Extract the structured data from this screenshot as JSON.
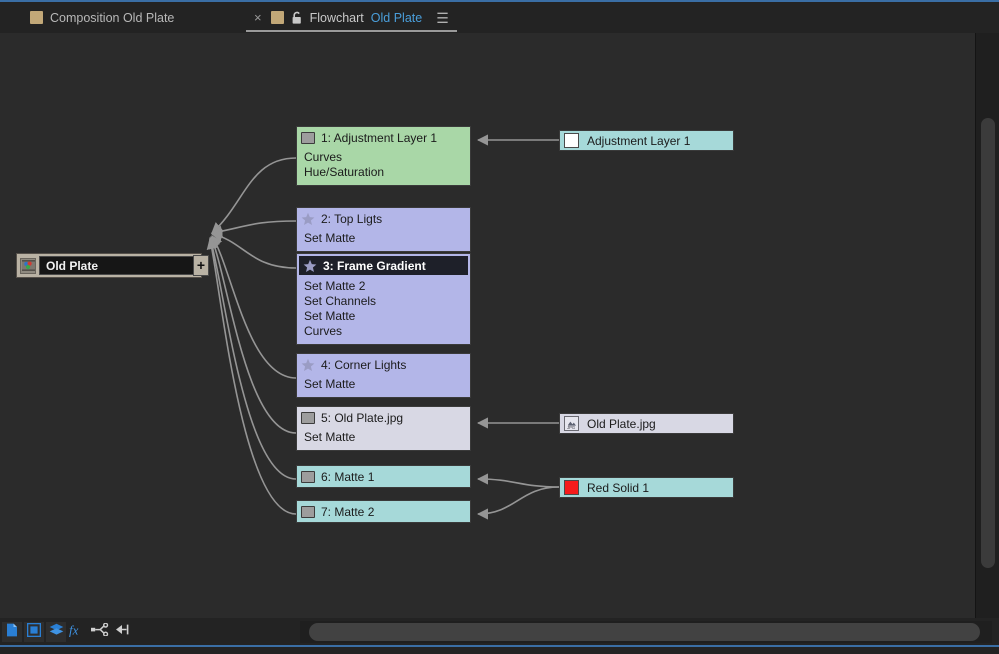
{
  "window": {
    "accent_color": "#3a6ea5",
    "canvas_bg": "#2b2b2b",
    "panel_bg": "#232323"
  },
  "tabs": {
    "inactive": {
      "label": "Composition Old Plate",
      "icon": "composition-swatch-icon"
    },
    "active": {
      "close_label": "×",
      "icon": "composition-swatch-icon",
      "lock_icon": "lock-icon",
      "prefix": "Flowchart",
      "name": "Old Plate",
      "menu_icon": "panel-menu-icon",
      "name_color": "#4a9eda"
    }
  },
  "composition_node": {
    "name": "Old Plate",
    "icon": "composition-thumbnail-icon",
    "expander_label": "+",
    "expander_name": "expand-composition-button"
  },
  "layer_nodes": [
    {
      "index": "1",
      "title": "1: Adjustment Layer 1",
      "icon": "layer-square-icon",
      "color": "#a9d7a7",
      "selected": false,
      "effects": [
        "Curves",
        "Hue/Saturation"
      ]
    },
    {
      "index": "2",
      "title": "2: Top Ligts",
      "icon": "shape-star-icon",
      "color": "#b3b6e8",
      "selected": false,
      "effects": [
        "Set Matte"
      ]
    },
    {
      "index": "3",
      "title": "3: Frame Gradient",
      "icon": "shape-star-icon",
      "color": "#b3b6e8",
      "selected": true,
      "effects": [
        "Set Matte 2",
        "Set Channels",
        "Set Matte",
        "Curves"
      ]
    },
    {
      "index": "4",
      "title": "4: Corner Lights",
      "icon": "shape-star-icon",
      "color": "#b3b6e8",
      "selected": false,
      "effects": [
        "Set Matte"
      ]
    },
    {
      "index": "5",
      "title": "5: Old Plate.jpg",
      "icon": "layer-square-icon",
      "color": "#d8d8e4",
      "selected": false,
      "effects": [
        "Set Matte"
      ]
    },
    {
      "index": "6",
      "title": "6: Matte 1",
      "icon": "layer-square-icon",
      "color": "#a6d9d9",
      "selected": false,
      "effects": []
    },
    {
      "index": "7",
      "title": "7: Matte 2",
      "icon": "layer-square-icon",
      "color": "#a6d9d9",
      "selected": false,
      "effects": []
    }
  ],
  "source_nodes": [
    {
      "title": "Adjustment Layer 1",
      "icon": "white-solid-swatch-icon",
      "swatch_color": "#ffffff",
      "color": "#a6d9d9"
    },
    {
      "title": "Old Plate.jpg",
      "icon": "jpeg-file-icon",
      "swatch_color": "#d8d8e4",
      "color": "#d8d8e4"
    },
    {
      "title": "Red Solid 1",
      "icon": "red-solid-swatch-icon",
      "swatch_color": "#f51b1b",
      "color": "#a6d9d9"
    }
  ],
  "toolbar": {
    "buttons": [
      {
        "name": "show-compositions-button",
        "icon": "page-icon"
      },
      {
        "name": "show-solids-button",
        "icon": "solid-square-icon"
      },
      {
        "name": "show-layers-button",
        "icon": "layers-icon"
      },
      {
        "name": "show-effects-button",
        "icon": "fx-icon"
      },
      {
        "name": "straight-lines-button",
        "icon": "node-link-icon"
      },
      {
        "name": "flow-direction-button",
        "icon": "left-arrow-icon"
      }
    ]
  },
  "scrollbars": {
    "vertical_name": "vertical-scrollbar",
    "horizontal_name": "horizontal-scrollbar"
  },
  "cursor": {
    "icon": "pointer-cursor-icon"
  }
}
